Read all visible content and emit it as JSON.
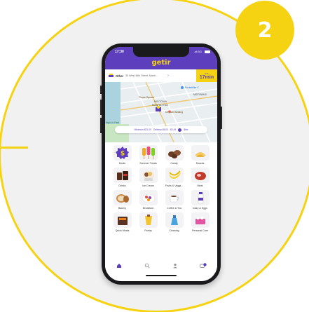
{
  "step_number": "2",
  "app": {
    "logo": "getir",
    "time": "17:30",
    "network": "all 5G"
  },
  "address": {
    "label": "Other",
    "text": "30 West 46th Street, Manh...",
    "eta_label": "ETA",
    "eta_value": "17min"
  },
  "map": {
    "labels": [
      "Times Square",
      "MIDTOWN",
      "MANHATTAN",
      "Chrysler Building",
      "Rockefeller C",
      "MIDTOWN E",
      "High Lir Park"
    ],
    "banner_minimum": "Minimum $21.00",
    "banner_delivery": "Delivery $6.00 - $3.49",
    "banner_extra": "$itm"
  },
  "categories": [
    {
      "label": "Deals",
      "icon": "deals-icon"
    },
    {
      "label": "Summer Treats",
      "icon": "popsicle-icon"
    },
    {
      "label": "Candy",
      "icon": "candy-icon"
    },
    {
      "label": "Snacks",
      "icon": "snacks-icon"
    },
    {
      "label": "Drinks",
      "icon": "drinks-icon"
    },
    {
      "label": "Ice Cream",
      "icon": "ice-cream-icon"
    },
    {
      "label": "Fruits & Veggi...",
      "icon": "banana-icon"
    },
    {
      "label": "Meat",
      "icon": "meat-icon"
    },
    {
      "label": "Bakery",
      "icon": "bread-icon"
    },
    {
      "label": "Breakfast",
      "icon": "breakfast-icon"
    },
    {
      "label": "Coffee & Tea",
      "icon": "coffee-icon"
    },
    {
      "label": "Dairy & Eggs",
      "icon": "milk-icon"
    },
    {
      "label": "Quick Meals",
      "icon": "quick-meals-icon"
    },
    {
      "label": "Pantry",
      "icon": "pantry-icon"
    },
    {
      "label": "Cleaning",
      "icon": "cleaning-icon"
    },
    {
      "label": "Personal Care",
      "icon": "personal-care-icon"
    }
  ],
  "tabs": [
    "home",
    "search",
    "profile",
    "cart"
  ],
  "colors": {
    "brand_purple": "#5d3ebc",
    "brand_yellow": "#f6d312"
  }
}
